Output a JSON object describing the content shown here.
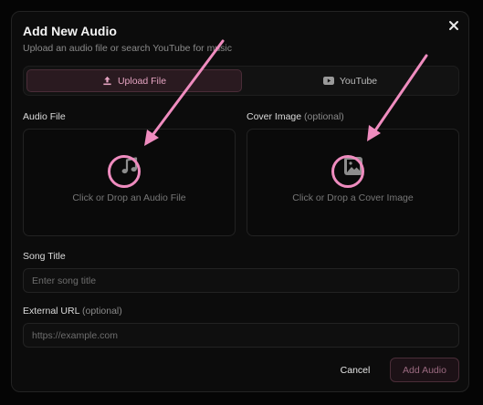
{
  "dialog": {
    "title": "Add New Audio",
    "subtitle": "Upload an audio file or search YouTube for music",
    "close_icon": "close-icon"
  },
  "tabs": [
    {
      "label": "Upload File",
      "icon": "upload-icon",
      "active": true
    },
    {
      "label": "YouTube",
      "icon": "youtube-icon",
      "active": false
    }
  ],
  "audio_file": {
    "label": "Audio File",
    "drop_text": "Click or Drop an Audio File",
    "icon": "music-note-icon"
  },
  "cover_image": {
    "label": "Cover Image",
    "label_optional": "(optional)",
    "drop_text": "Click or Drop a Cover Image",
    "icon": "image-icon"
  },
  "song_title": {
    "label": "Song Title",
    "placeholder": "Enter song title",
    "value": ""
  },
  "external_url": {
    "label": "External URL",
    "label_optional": "(optional)",
    "placeholder": "https://example.com",
    "value": ""
  },
  "actions": {
    "cancel_label": "Cancel",
    "add_label": "Add Audio"
  },
  "colors": {
    "accent": "#e6a4c2",
    "annotation": "#ef8cbf",
    "background": "#0c0c0c"
  }
}
